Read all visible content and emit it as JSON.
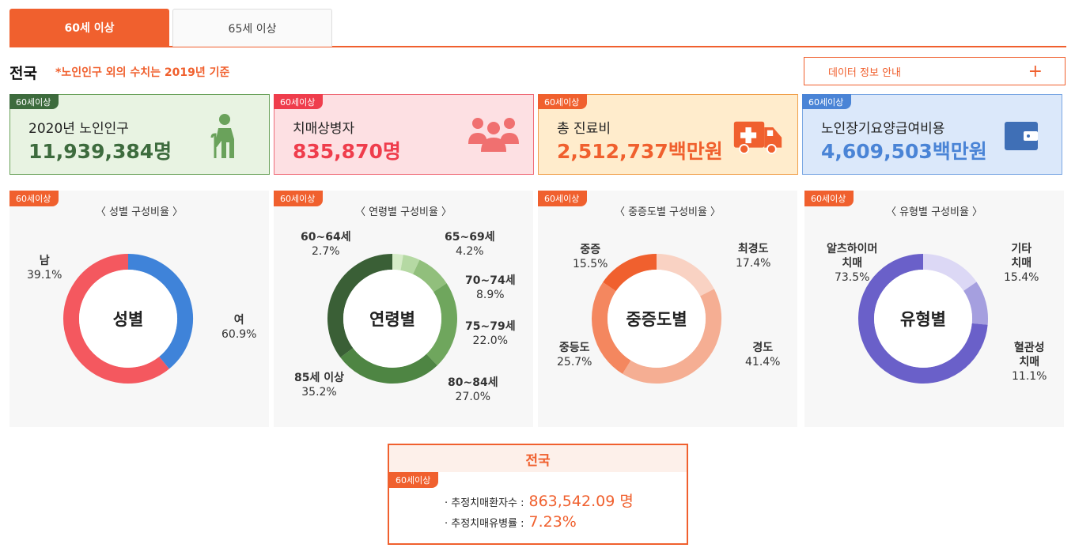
{
  "tabs": [
    {
      "label": "60세 이상"
    },
    {
      "label": "65세 이상"
    }
  ],
  "region": "전국",
  "note": "*노인인구 외의 수치는 2019년 기준",
  "info_button": {
    "label": "데이터 정보 안내",
    "icon": "plus-icon"
  },
  "badge": "60세이상",
  "cards": [
    {
      "label": "2020년 노인인구",
      "value": "11,939,384명",
      "icon": "elderly-person-icon",
      "color": "#3d6b3d",
      "bg": "#e8f3e2",
      "border": "#6aa25b",
      "badge": "#3d6b3d"
    },
    {
      "label": "치매상병자",
      "value": "835,870명",
      "icon": "people-group-icon",
      "color": "#ef3d4c",
      "bg": "#fde0e3",
      "border": "#ef6b78",
      "badge": "#ef3d4c"
    },
    {
      "label": "총 진료비",
      "value": "2,512,737백만원",
      "icon": "ambulance-icon",
      "color": "#f0602e",
      "bg": "#ffeccc",
      "border": "#f0a04a",
      "badge": "#f0602e"
    },
    {
      "label": "노인장기요양급여비용",
      "value": "4,609,503백만원",
      "icon": "wallet-icon",
      "color": "#4a84d6",
      "bg": "#dbe8fa",
      "border": "#7aa7e3",
      "badge": "#4a84d6"
    }
  ],
  "charts": [
    {
      "title": "〈 성별 구성비율 〉",
      "center": "성별",
      "chart_data": {
        "type": "pie",
        "categories": [
          "남",
          "여"
        ],
        "values": [
          39.1,
          60.9
        ],
        "colors": [
          "#3f83d9",
          "#f4585f"
        ]
      },
      "labels": [
        {
          "name": "남",
          "pct": "39.1%"
        },
        {
          "name": "여",
          "pct": "60.9%"
        }
      ]
    },
    {
      "title": "〈 연령별 구성비율 〉",
      "center": "연령별",
      "chart_data": {
        "type": "pie",
        "categories": [
          "60~64세",
          "65~69세",
          "70~74세",
          "75~79세",
          "80~84세",
          "85세 이상"
        ],
        "values": [
          2.7,
          4.2,
          8.9,
          22.0,
          27.0,
          35.2
        ],
        "colors": [
          "#d6ecc8",
          "#b5d9a3",
          "#91bf7c",
          "#6fa65d",
          "#4e8543",
          "#3a5f36"
        ]
      },
      "labels": [
        {
          "name": "60~64세",
          "pct": "2.7%"
        },
        {
          "name": "65~69세",
          "pct": "4.2%"
        },
        {
          "name": "70~74세",
          "pct": "8.9%"
        },
        {
          "name": "75~79세",
          "pct": "22.0%"
        },
        {
          "name": "80~84세",
          "pct": "27.0%"
        },
        {
          "name": "85세 이상",
          "pct": "35.2%"
        }
      ]
    },
    {
      "title": "〈 중증도별 구성비율 〉",
      "center": "중증도별",
      "chart_data": {
        "type": "pie",
        "categories": [
          "최경도",
          "경도",
          "중등도",
          "중증"
        ],
        "values": [
          17.4,
          41.4,
          25.7,
          15.5
        ],
        "colors": [
          "#f9d2c3",
          "#f5ae93",
          "#f4875f",
          "#f0602e"
        ]
      },
      "labels": [
        {
          "name": "최경도",
          "pct": "17.4%"
        },
        {
          "name": "경도",
          "pct": "41.4%"
        },
        {
          "name": "중등도",
          "pct": "25.7%"
        },
        {
          "name": "중증",
          "pct": "15.5%"
        }
      ]
    },
    {
      "title": "〈 유형별 구성비율 〉",
      "center": "유형별",
      "chart_data": {
        "type": "pie",
        "categories": [
          "기타 치매",
          "혈관성 치매",
          "알츠하이머 치매"
        ],
        "values": [
          15.4,
          11.1,
          73.5
        ],
        "colors": [
          "#dcd8f5",
          "#a59fdf",
          "#6a60c9"
        ]
      },
      "labels": [
        {
          "name": "기타\n치매",
          "pct": "15.4%"
        },
        {
          "name": "혈관성\n치매",
          "pct": "11.1%"
        },
        {
          "name": "알츠하이머\n치매",
          "pct": "73.5%"
        }
      ]
    }
  ],
  "bottom": {
    "title": "전국",
    "rows": [
      {
        "label": "· 추정치매환자수 :",
        "value": "863,542.09 명"
      },
      {
        "label": "· 추정치매유병률 :",
        "value": "7.23%"
      }
    ]
  }
}
